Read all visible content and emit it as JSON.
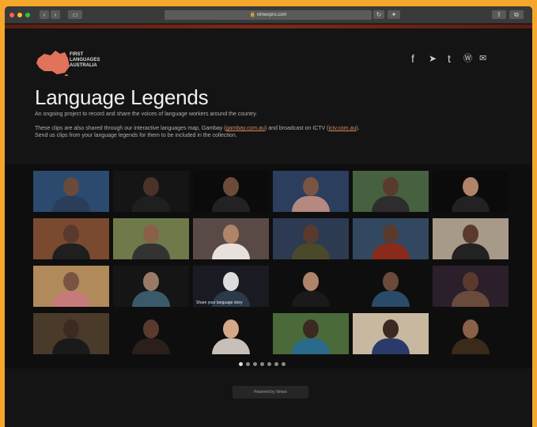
{
  "browser": {
    "url": "vimeopro.com"
  },
  "logo": {
    "line1": "FIRST",
    "line2": "LANGUAGES",
    "line3": "AUSTRALIA"
  },
  "social": [
    {
      "name": "facebook",
      "glyph": "f"
    },
    {
      "name": "twitter",
      "glyph": "➤"
    },
    {
      "name": "tumblr",
      "glyph": "t"
    },
    {
      "name": "wordpress",
      "glyph": "Ⓦ"
    },
    {
      "name": "email",
      "glyph": "✉"
    }
  ],
  "page": {
    "title": "Language Legends",
    "intro": "An ongoing project to record and share the voices of language workers around the country.",
    "desc_part1": "These clips are also shared through our interactive languages map, Gambay (",
    "desc_link1": "gambay.com.au",
    "desc_part2": ") and broadcast on ICTV (",
    "desc_link2": "ictv.com.au",
    "desc_part3": "). Send us clips from your language legends for them to be included in the collection."
  },
  "gallery": {
    "thumbs": [
      {
        "bg": "#2b4a6e",
        "skin": "#6a4a3a",
        "shirt": "#2a3d5a",
        "label": ""
      },
      {
        "bg": "#151515",
        "skin": "#4a3228",
        "shirt": "#1f1f1f",
        "label": ""
      },
      {
        "bg": "#0b0b0b",
        "skin": "#6e4a3a",
        "shirt": "#222",
        "label": ""
      },
      {
        "bg": "#2b3e5e",
        "skin": "#7a5442",
        "shirt": "#b58880",
        "label": ""
      },
      {
        "bg": "#466040",
        "skin": "#5a3a2c",
        "shirt": "#2d2d2d",
        "label": ""
      },
      {
        "bg": "#0b0b0b",
        "skin": "#b08468",
        "shirt": "#222",
        "label": ""
      },
      {
        "bg": "#7a4a30",
        "skin": "#5a3a2c",
        "shirt": "#1f1f1f",
        "label": ""
      },
      {
        "bg": "#6e7a4a",
        "skin": "#8a6048",
        "shirt": "#333",
        "label": ""
      },
      {
        "bg": "#5a4a46",
        "skin": "#b08468",
        "shirt": "#e8e0dc",
        "label": ""
      },
      {
        "bg": "#2c3a52",
        "skin": "#5a3a2c",
        "shirt": "#4a4a2a",
        "label": ""
      },
      {
        "bg": "#324860",
        "skin": "#5a3a2c",
        "shirt": "#8a2a1a",
        "label": ""
      },
      {
        "bg": "#a89a88",
        "skin": "#5a3a2c",
        "shirt": "#222",
        "label": ""
      },
      {
        "bg": "#b08a5a",
        "skin": "#7a5442",
        "shirt": "#c77a7a",
        "label": ""
      },
      {
        "bg": "#151515",
        "skin": "#9a7a66",
        "shirt": "#3a5a6a",
        "label": ""
      },
      {
        "bg": "#1a1a22",
        "skin": "#dcdcdc",
        "shirt": "#2a3a4a",
        "label": "Share your language story"
      },
      {
        "bg": "#0e0e0e",
        "skin": "#b08468",
        "shirt": "#1a1a1a",
        "label": ""
      },
      {
        "bg": "#0e0e0e",
        "skin": "#6a4a3a",
        "shirt": "#2a4a6a",
        "label": ""
      },
      {
        "bg": "#2a1f2a",
        "skin": "#5a3a2c",
        "shirt": "#6a4a3a",
        "label": ""
      },
      {
        "bg": "#4a3a2a",
        "skin": "#3a2a22",
        "shirt": "#1a1a1a",
        "label": ""
      },
      {
        "bg": "#0e0e0e",
        "skin": "#5a3a2c",
        "shirt": "#2a1f1a",
        "label": ""
      },
      {
        "bg": "#0e0e0e",
        "skin": "#d4a888",
        "shirt": "#c8c0b8",
        "label": ""
      },
      {
        "bg": "#4a6a3a",
        "skin": "#3a2a22",
        "shirt": "#2a6a8a",
        "label": ""
      },
      {
        "bg": "#c8b8a0",
        "skin": "#3a2a22",
        "shirt": "#2a3a6a",
        "label": ""
      },
      {
        "bg": "#0e0e0e",
        "skin": "#8a6048",
        "shirt": "#3a2a1a",
        "label": ""
      }
    ],
    "pages": 7,
    "active_page": 1
  },
  "footer": {
    "powered_by": "Powered by Vimeo"
  }
}
